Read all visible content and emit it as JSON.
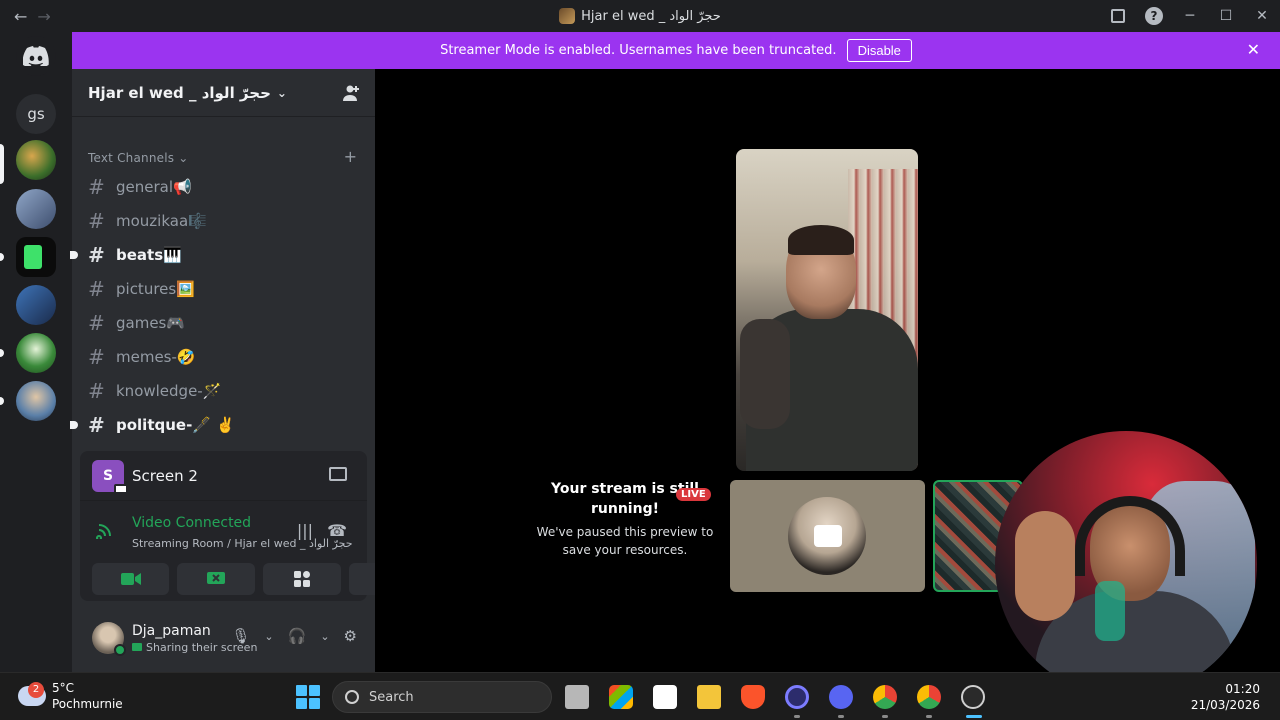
{
  "window": {
    "title": "Hjar el wed _ حجرّ الواد",
    "back_icon": "←",
    "forward_icon": "→",
    "minimize": "─",
    "maximize": "☐",
    "close": "✕",
    "help": "?"
  },
  "banner": {
    "message": "Streamer Mode is enabled. Usernames have been truncated.",
    "disable_label": "Disable",
    "close": "✕",
    "color": "#9b34f0"
  },
  "guilds": {
    "home_label": "gs"
  },
  "server": {
    "name": "Hjar el wed _ حجرّ الواد",
    "chevron": "⌄"
  },
  "channels": {
    "category": "Text Channels",
    "category_chevron": "⌄",
    "add": "+",
    "items": [
      {
        "name": "general📢",
        "unread": false
      },
      {
        "name": "mouzikaa🎼",
        "unread": false
      },
      {
        "name": "beats🎹",
        "unread": true
      },
      {
        "name": "pictures🖼️",
        "unread": false
      },
      {
        "name": "games🎮",
        "unread": false
      },
      {
        "name": "memes-🤣",
        "unread": false
      },
      {
        "name": "knowledge-🪄",
        "unread": false
      },
      {
        "name": "politque-🖋️ ✌️",
        "unread": true
      }
    ]
  },
  "stream_panel": {
    "avatar_letter": "S",
    "screen_label": "Screen 2",
    "status": "Video Connected",
    "location": "Streaming Room / Hjar el wed _ حجرّ الواد",
    "status_color": "#23a559"
  },
  "user": {
    "name": "Dja_paman",
    "status": "Sharing their screen"
  },
  "stage": {
    "live_badge": "LIVE",
    "paused_title": "Your stream is still running!",
    "paused_body": "We've paused this preview to save your resources."
  },
  "taskbar": {
    "weather_badge": "2",
    "temperature": "5°C",
    "location": "Pochmurnie",
    "search_placeholder": "Search",
    "time": "01:20",
    "date": "21/03/2026"
  }
}
